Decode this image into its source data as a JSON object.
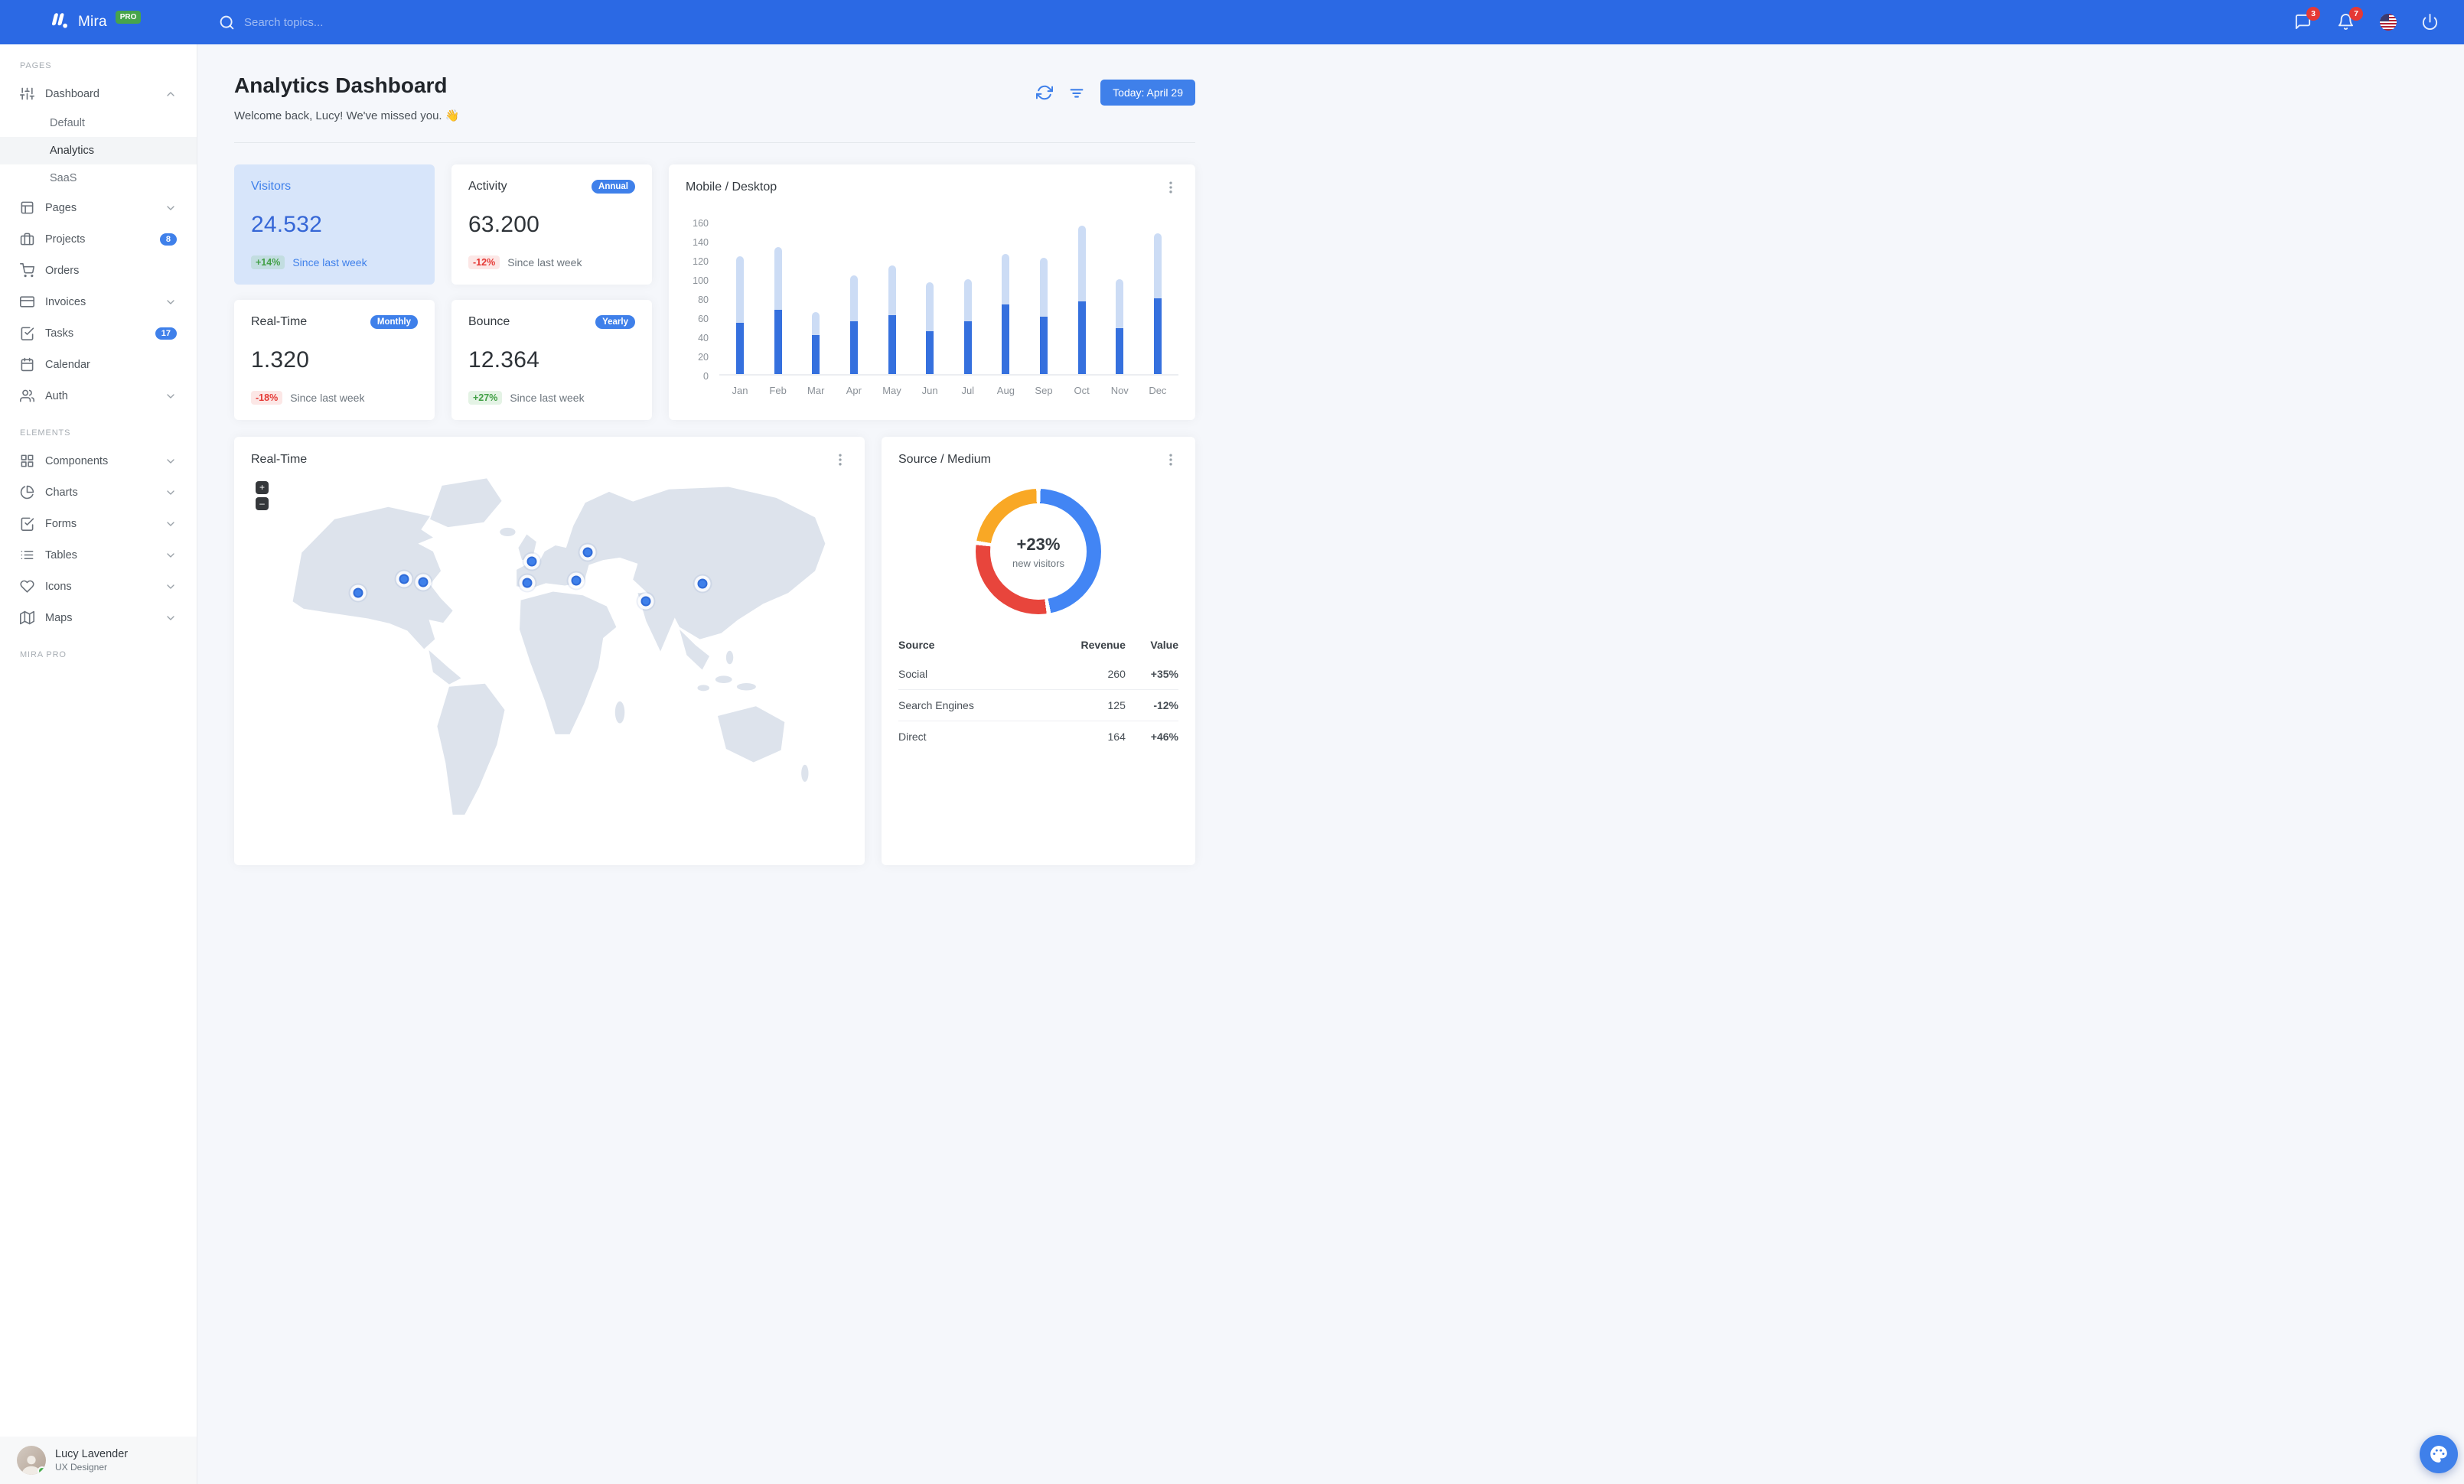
{
  "colors": {
    "primary": "#3F80EA",
    "navbar": "#2B69E4",
    "bar_mobile": "#3570DE",
    "bar_desktop": "#CCDCF5",
    "donut_blue": "#4285F4",
    "donut_red": "#E8453C",
    "donut_orange": "#F9A825",
    "positive": "#43A047",
    "negative": "#E53935",
    "pro_badge": "#47A44B",
    "alert_badge": "#E53935",
    "highlight_card_bg": "#D7E5FA"
  },
  "icons": {
    "search": "search-icon",
    "messages": "message-square-icon",
    "notifications": "bell-icon",
    "language": "us-flag-icon",
    "power": "power-icon",
    "refresh": "refresh-icon",
    "filter": "filter-icon",
    "more": "more-vertical-icon",
    "palette": "palette-icon",
    "zoom_in": "plus-icon",
    "zoom_out": "minus-icon"
  },
  "navbar": {
    "brand": "Mira",
    "brand_badge": "PRO",
    "search_placeholder": "Search topics...",
    "messages_badge": "3",
    "notifications_badge": "7"
  },
  "sidebar": {
    "sections": [
      {
        "label": "PAGES",
        "items": [
          {
            "label": "Dashboard",
            "icon": "sliders",
            "chevron": "up",
            "children": [
              {
                "label": "Default",
                "active": false
              },
              {
                "label": "Analytics",
                "active": true
              },
              {
                "label": "SaaS",
                "active": false
              }
            ]
          },
          {
            "label": "Pages",
            "icon": "layout",
            "chevron": "down"
          },
          {
            "label": "Projects",
            "icon": "briefcase",
            "badge": "8"
          },
          {
            "label": "Orders",
            "icon": "shopping-cart"
          },
          {
            "label": "Invoices",
            "icon": "credit-card",
            "chevron": "down"
          },
          {
            "label": "Tasks",
            "icon": "check-square",
            "badge": "17"
          },
          {
            "label": "Calendar",
            "icon": "calendar"
          },
          {
            "label": "Auth",
            "icon": "users",
            "chevron": "down"
          }
        ]
      },
      {
        "label": "ELEMENTS",
        "items": [
          {
            "label": "Components",
            "icon": "grid",
            "chevron": "down"
          },
          {
            "label": "Charts",
            "icon": "pie-chart",
            "chevron": "down"
          },
          {
            "label": "Forms",
            "icon": "check-square",
            "chevron": "down"
          },
          {
            "label": "Tables",
            "icon": "list",
            "chevron": "down"
          },
          {
            "label": "Icons",
            "icon": "heart",
            "chevron": "down"
          },
          {
            "label": "Maps",
            "icon": "map",
            "chevron": "down"
          }
        ]
      },
      {
        "label": "MIRA PRO",
        "items": []
      }
    ],
    "user": {
      "name": "Lucy Lavender",
      "role": "UX Designer",
      "status": "online"
    }
  },
  "header": {
    "title": "Analytics Dashboard",
    "subtitle": "Welcome back, Lucy! We've missed you. 👋",
    "date_button": "Today: April 29"
  },
  "stats": [
    {
      "title": "Visitors",
      "value": "24.532",
      "delta": "+14%",
      "trend": "up",
      "note": "Since last week",
      "highlighted": true
    },
    {
      "title": "Activity",
      "value": "63.200",
      "delta": "-12%",
      "trend": "down",
      "note": "Since last week",
      "badge": "Annual"
    },
    {
      "title": "Real-Time",
      "value": "1.320",
      "delta": "-18%",
      "trend": "down",
      "note": "Since last week",
      "badge": "Monthly"
    },
    {
      "title": "Bounce",
      "value": "12.364",
      "delta": "+27%",
      "trend": "up",
      "note": "Since last week",
      "badge": "Yearly"
    }
  ],
  "chart_data": [
    {
      "type": "bar",
      "stacked": true,
      "title": "Mobile / Desktop",
      "categories": [
        "Jan",
        "Feb",
        "Mar",
        "Apr",
        "May",
        "Jun",
        "Jul",
        "Aug",
        "Sep",
        "Oct",
        "Nov",
        "Dec"
      ],
      "series": [
        {
          "name": "Mobile",
          "color": "#3570DE",
          "values": [
            54,
            67,
            41,
            55,
            62,
            45,
            55,
            73,
            60,
            76,
            48,
            79
          ]
        },
        {
          "name": "Desktop",
          "color": "#CCDCF5",
          "values": [
            69,
            66,
            24,
            48,
            52,
            51,
            44,
            53,
            62,
            79,
            51,
            68
          ]
        }
      ],
      "ylim": [
        0,
        160
      ],
      "yticks": [
        0,
        20,
        40,
        60,
        80,
        100,
        120,
        140,
        160
      ],
      "grid": false,
      "legend": "none"
    },
    {
      "type": "donut",
      "title": "Source / Medium",
      "center_label": "+23%",
      "center_sublabel": "new visitors",
      "segments": [
        {
          "name": "Social",
          "value": 260,
          "color": "#4285F4"
        },
        {
          "name": "Direct",
          "value": 164,
          "color": "#E8453C"
        },
        {
          "name": "Search Engines",
          "value": 125,
          "color": "#F9A825"
        }
      ]
    }
  ],
  "realtime": {
    "title": "Real-Time",
    "zoom_in": "+",
    "zoom_out": "–",
    "markers": [
      {
        "x": 18.0,
        "y": 34.9
      },
      {
        "x": 25.6,
        "y": 30.9
      },
      {
        "x": 28.9,
        "y": 31.8
      },
      {
        "x": 47.0,
        "y": 25.7
      },
      {
        "x": 46.3,
        "y": 32.1
      },
      {
        "x": 54.5,
        "y": 31.4
      },
      {
        "x": 56.4,
        "y": 23.0
      },
      {
        "x": 66.1,
        "y": 37.5
      },
      {
        "x": 75.6,
        "y": 32.3
      }
    ]
  },
  "source_medium": {
    "title": "Source / Medium",
    "table": {
      "headers": [
        "Source",
        "Revenue",
        "Value"
      ],
      "rows": [
        {
          "source": "Social",
          "revenue": "260",
          "value": "+35%",
          "trend": "up"
        },
        {
          "source": "Search Engines",
          "revenue": "125",
          "value": "-12%",
          "trend": "down"
        },
        {
          "source": "Direct",
          "revenue": "164",
          "value": "+46%",
          "trend": "up"
        }
      ]
    }
  }
}
